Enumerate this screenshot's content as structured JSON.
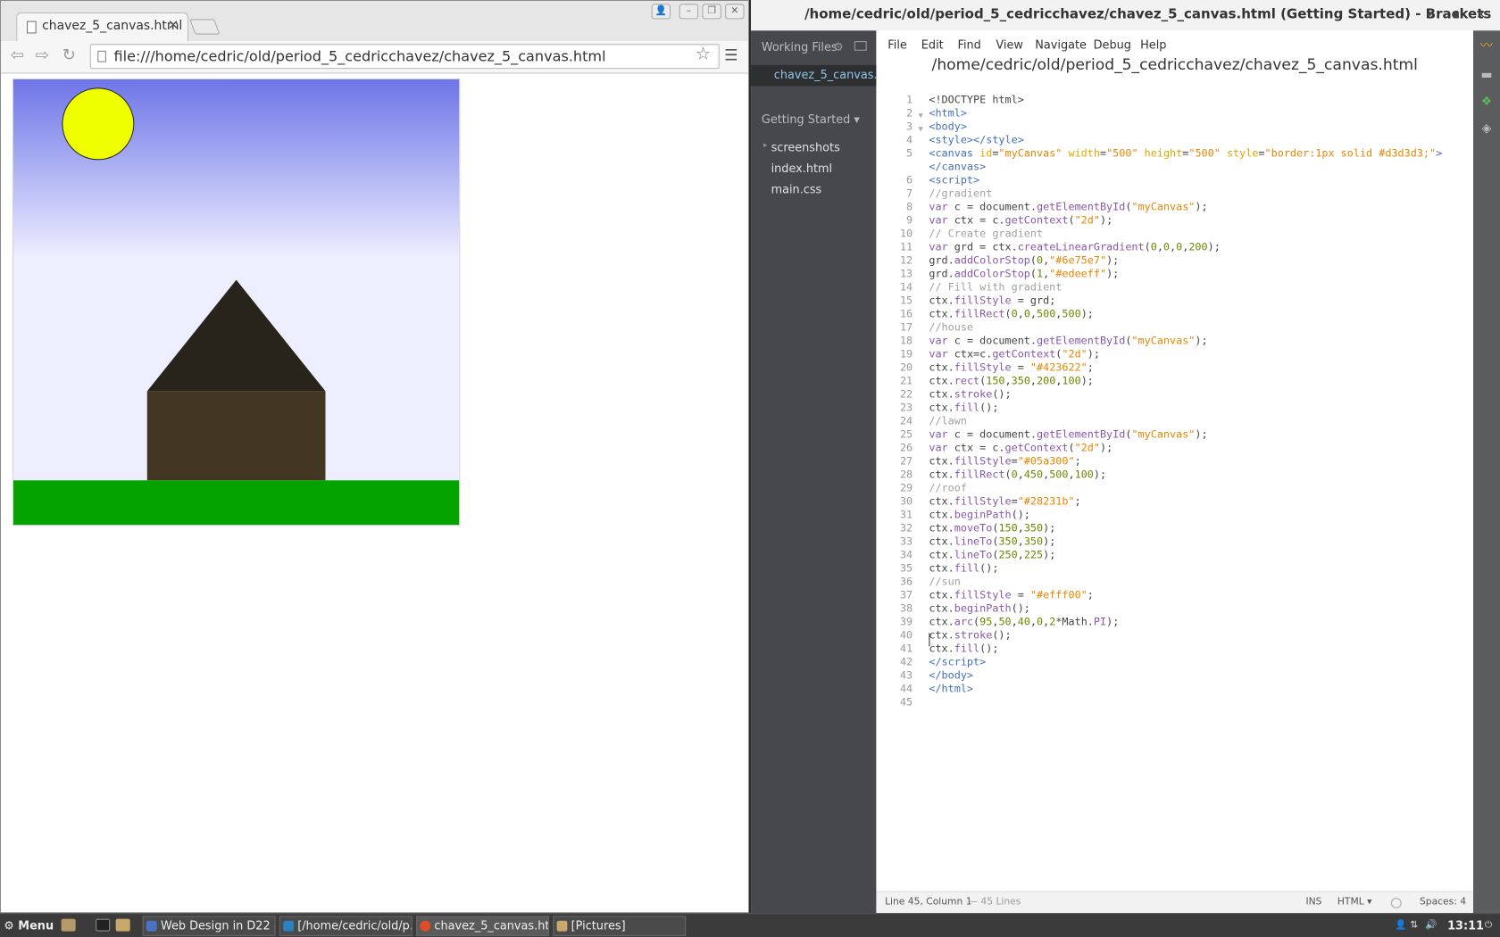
{
  "browser": {
    "tab_title": "chavez_5_canvas.html",
    "url": "file:///home/cedric/old/period_5_cedricchavez/chavez_5_canvas.html"
  },
  "canvas": {
    "gradient_top": "#6e75e7",
    "gradient_bottom": "#edeeff",
    "house_color": "#423622",
    "lawn_color": "#05a300",
    "roof_color": "#28231b",
    "sun_color": "#efff00"
  },
  "editor": {
    "window_title": "/home/cedric/old/period_5_cedricchavez/chavez_5_canvas.html (Getting Started) - Brackets",
    "menu": [
      "File",
      "Edit",
      "Find",
      "View",
      "Navigate",
      "Debug",
      "Help"
    ],
    "file_title": "/home/cedric/old/period_5_cedricchavez/chavez_5_canvas.html",
    "working_files_label": "Working Files",
    "active_file": "chavez_5_canvas.h",
    "project_label": "Getting Started ▾",
    "tree": [
      "screenshots",
      "index.html",
      "main.css"
    ],
    "status": {
      "position": "Line 45, Column 1",
      "lines": "— 45 Lines",
      "ins": "INS",
      "mode": "HTML ▾",
      "spaces": "Spaces: 4"
    },
    "lines": [
      {
        "n": "1",
        "h": "&lt;!DOCTYPE html&gt;"
      },
      {
        "n": "2",
        "f": true,
        "h": "<span class='tag'>&lt;html&gt;</span>"
      },
      {
        "n": "3",
        "f": true,
        "h": "<span class='tag'>&lt;body&gt;</span>"
      },
      {
        "n": "4",
        "h": "<span class='tag'>&lt;style&gt;&lt;/style&gt;</span>"
      },
      {
        "n": "5",
        "h": "<span class='tag'>&lt;canvas</span> <span class='attr'>id</span>=<span class='str'>\"myCanvas\"</span> <span class='attr'>width</span>=<span class='str'>\"500\"</span> <span class='attr'>height</span>=<span class='str'>\"500\"</span> <span class='attr'>style</span>=<span class='str'>\"border:1px solid #d3d3d3;\"</span><span class='tag'>&gt;</span>"
      },
      {
        "n": "",
        "h": "<span class='tag'>&lt;/canvas&gt;</span>"
      },
      {
        "n": "6",
        "h": "<span class='tag'>&lt;script&gt;</span>"
      },
      {
        "n": "7",
        "h": "<span class='cmt'>//gradient</span>"
      },
      {
        "n": "8",
        "h": "<span class='kw'>var</span> c = document.<span class='fn'>getElementById</span>(<span class='str'>\"myCanvas\"</span>);"
      },
      {
        "n": "9",
        "h": "<span class='kw'>var</span> ctx = c.<span class='fn'>getContext</span>(<span class='str'>\"2d\"</span>);"
      },
      {
        "n": "10",
        "h": "<span class='cmt'>// Create gradient</span>"
      },
      {
        "n": "11",
        "h": "<span class='kw'>var</span> grd = ctx.<span class='fn'>createLinearGradient</span>(<span class='num'>0</span>,<span class='num'>0</span>,<span class='num'>0</span>,<span class='num'>200</span>);"
      },
      {
        "n": "12",
        "h": "grd.<span class='fn'>addColorStop</span>(<span class='num'>0</span>,<span class='str'>\"#6e75e7\"</span>);"
      },
      {
        "n": "13",
        "h": "grd.<span class='fn'>addColorStop</span>(<span class='num'>1</span>,<span class='str'>\"#edeeff\"</span>);"
      },
      {
        "n": "14",
        "h": "<span class='cmt'>// Fill with gradient</span>"
      },
      {
        "n": "15",
        "h": "ctx.<span class='fn'>fillStyle</span> = grd;"
      },
      {
        "n": "16",
        "h": "ctx.<span class='fn'>fillRect</span>(<span class='num'>0</span>,<span class='num'>0</span>,<span class='num'>500</span>,<span class='num'>500</span>);"
      },
      {
        "n": "17",
        "h": "<span class='cmt'>//house</span>"
      },
      {
        "n": "18",
        "h": "<span class='kw'>var</span> c = document.<span class='fn'>getElementById</span>(<span class='str'>\"myCanvas\"</span>);"
      },
      {
        "n": "19",
        "h": "<span class='kw'>var</span> ctx=c.<span class='fn'>getContext</span>(<span class='str'>\"2d\"</span>);"
      },
      {
        "n": "20",
        "h": "ctx.<span class='fn'>fillStyle</span> = <span class='str'>\"#423622\"</span>;"
      },
      {
        "n": "21",
        "h": "ctx.<span class='fn'>rect</span>(<span class='num'>150</span>,<span class='num'>350</span>,<span class='num'>200</span>,<span class='num'>100</span>);"
      },
      {
        "n": "22",
        "h": "ctx.<span class='fn'>stroke</span>();"
      },
      {
        "n": "23",
        "h": "ctx.<span class='fn'>fill</span>();"
      },
      {
        "n": "24",
        "h": "<span class='cmt'>//lawn</span>"
      },
      {
        "n": "25",
        "h": "<span class='kw'>var</span> c = document.<span class='fn'>getElementById</span>(<span class='str'>\"myCanvas\"</span>);"
      },
      {
        "n": "26",
        "h": "<span class='kw'>var</span> ctx = c.<span class='fn'>getContext</span>(<span class='str'>\"2d\"</span>);"
      },
      {
        "n": "27",
        "h": "ctx.<span class='fn'>fillStyle</span>=<span class='str'>\"#05a300\"</span>;"
      },
      {
        "n": "28",
        "h": "ctx.<span class='fn'>fillRect</span>(<span class='num'>0</span>,<span class='num'>450</span>,<span class='num'>500</span>,<span class='num'>100</span>);"
      },
      {
        "n": "29",
        "h": "<span class='cmt'>//roof</span>"
      },
      {
        "n": "30",
        "h": "ctx.<span class='fn'>fillStyle</span>=<span class='str'>\"#28231b\"</span>;"
      },
      {
        "n": "31",
        "h": "ctx.<span class='fn'>beginPath</span>();"
      },
      {
        "n": "32",
        "h": "ctx.<span class='fn'>moveTo</span>(<span class='num'>150</span>,<span class='num'>350</span>);"
      },
      {
        "n": "33",
        "h": "ctx.<span class='fn'>lineTo</span>(<span class='num'>350</span>,<span class='num'>350</span>);"
      },
      {
        "n": "34",
        "h": "ctx.<span class='fn'>lineTo</span>(<span class='num'>250</span>,<span class='num'>225</span>);"
      },
      {
        "n": "35",
        "h": "ctx.<span class='fn'>fill</span>();"
      },
      {
        "n": "36",
        "h": "<span class='cmt'>//sun</span>"
      },
      {
        "n": "37",
        "h": "ctx.<span class='fn'>fillStyle</span> = <span class='str'>\"#efff00\"</span>;"
      },
      {
        "n": "38",
        "h": "ctx.<span class='fn'>beginPath</span>();"
      },
      {
        "n": "39",
        "h": "ctx.<span class='fn'>arc</span>(<span class='num'>95</span>,<span class='num'>50</span>,<span class='num'>40</span>,<span class='num'>0</span>,<span class='num'>2</span>*Math.<span class='fn'>PI</span>);"
      },
      {
        "n": "40",
        "h": "ctx.<span class='fn'>stroke</span>();"
      },
      {
        "n": "41",
        "h": "ctx.<span class='fn'>fill</span>();"
      },
      {
        "n": "42",
        "h": "<span class='tag'>&lt;/script&gt;</span>"
      },
      {
        "n": "43",
        "h": "<span class='tag'>&lt;/body&gt;</span>"
      },
      {
        "n": "44",
        "h": "<span class='tag'>&lt;/html&gt;</span>"
      },
      {
        "n": "45",
        "h": ""
      }
    ]
  },
  "taskbar": {
    "menu_label": "Menu",
    "items": [
      "Web Design in D22 -...",
      "[/home/cedric/old/p...",
      "chavez_5_canvas.ht...",
      "[Pictures]"
    ],
    "clock": "13:11"
  }
}
